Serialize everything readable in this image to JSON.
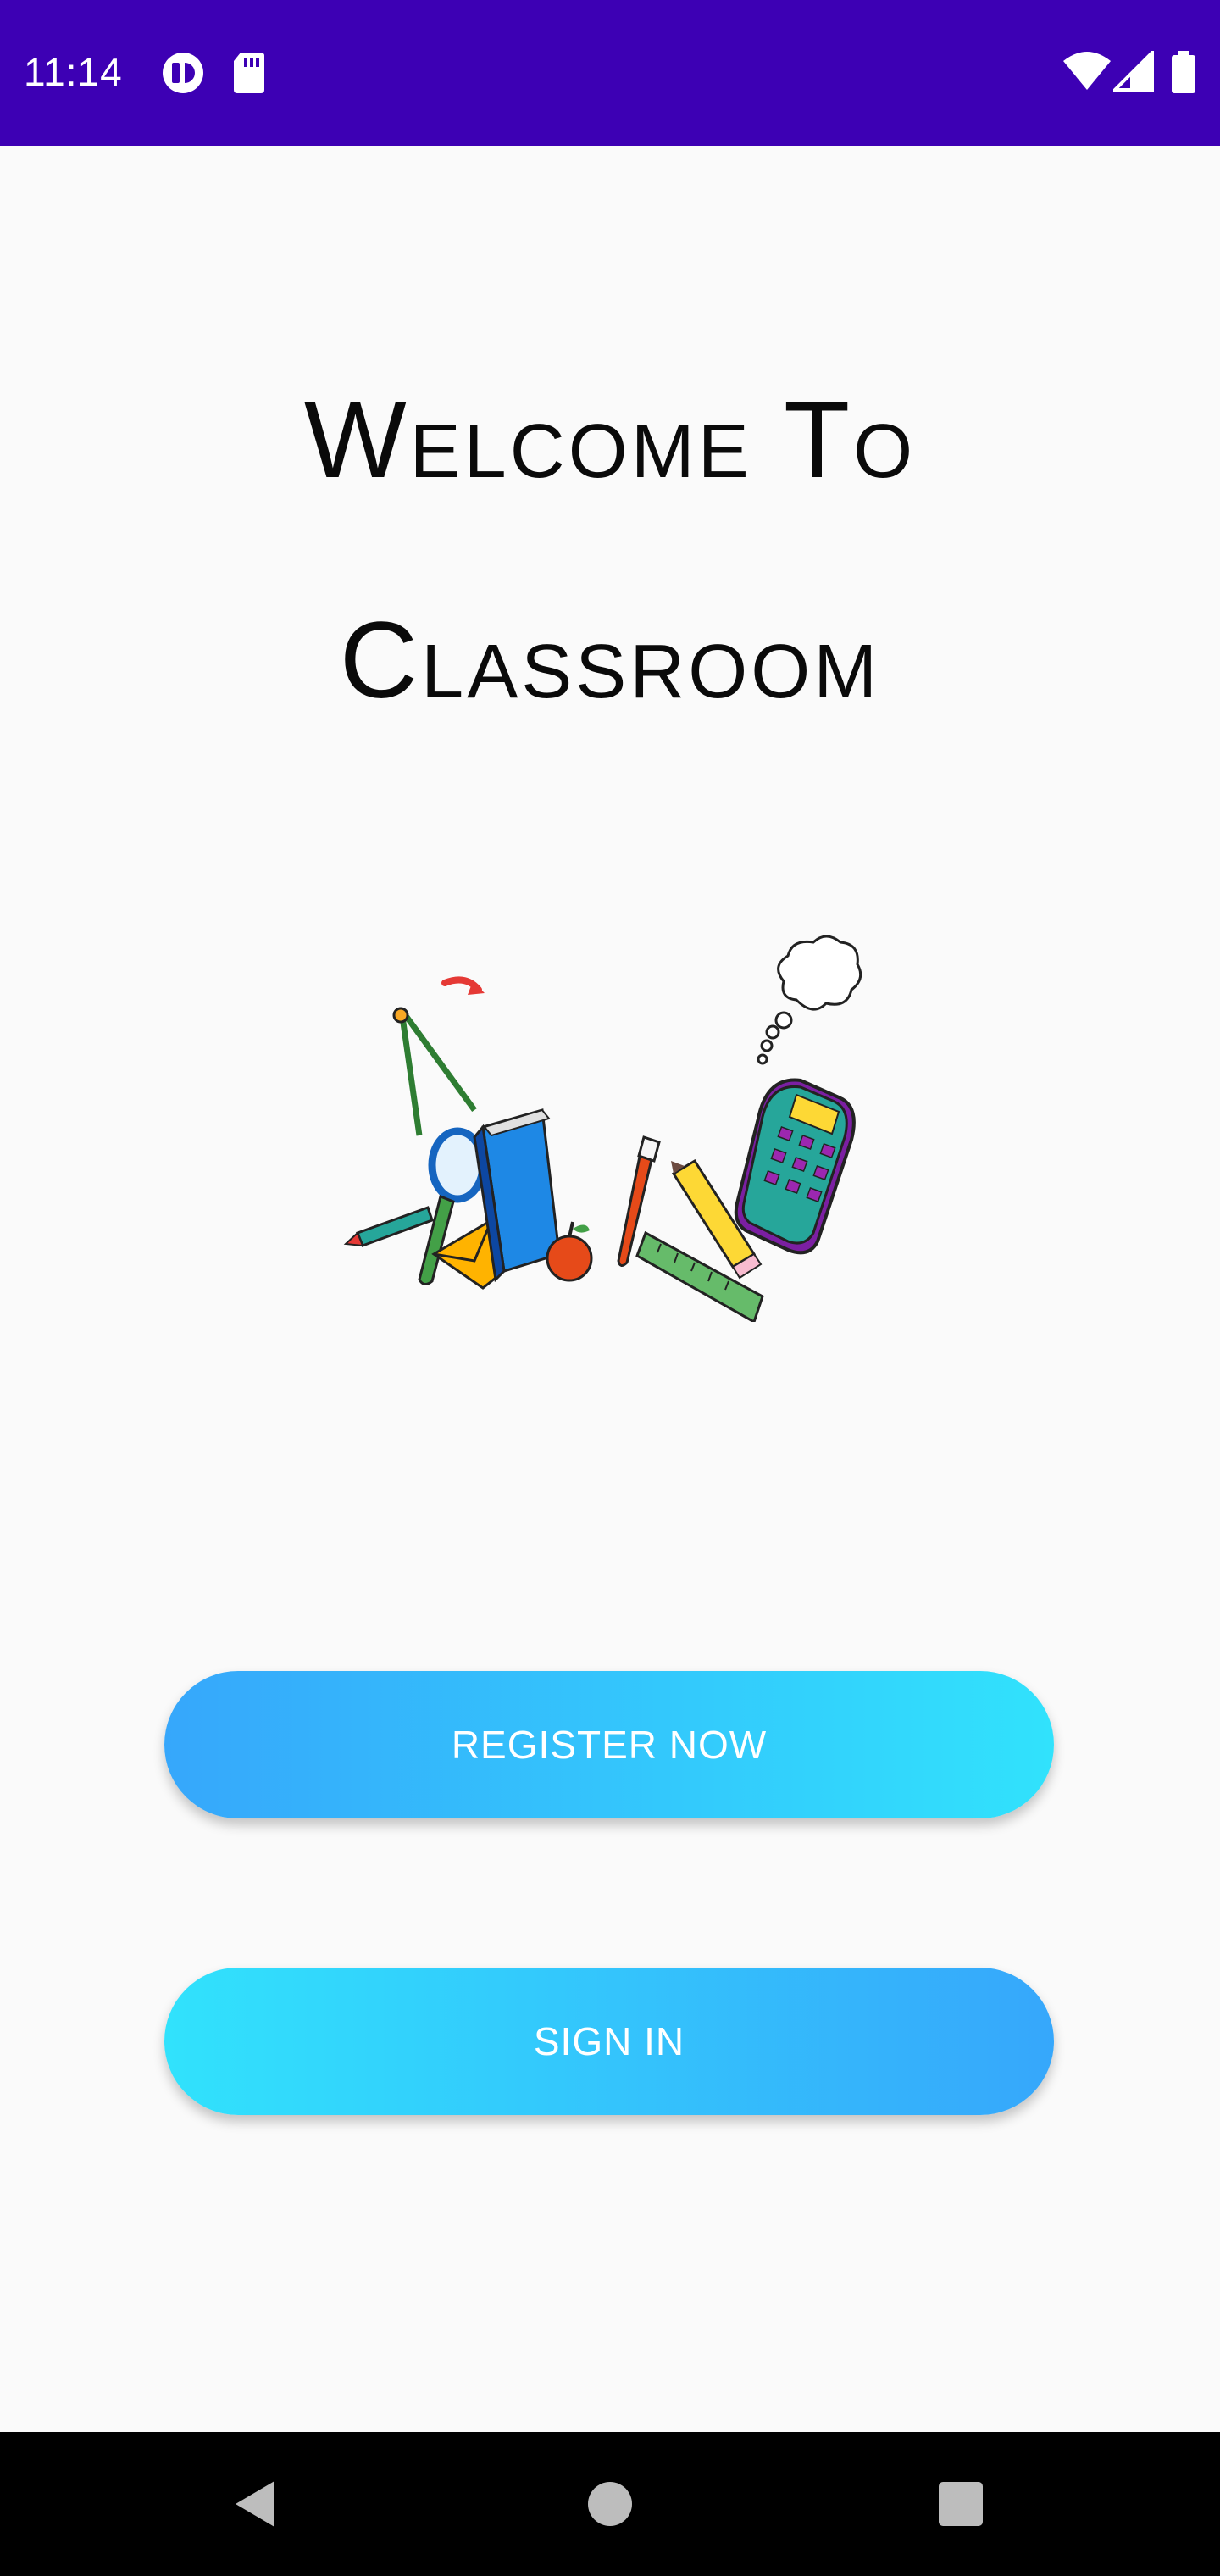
{
  "status_bar": {
    "time": "11:14",
    "background_color": "#3d00b4",
    "left_icons": [
      "media-player-icon",
      "sd-card-icon"
    ],
    "right_icons": [
      "wifi-icon",
      "cell-signal-icon",
      "battery-icon"
    ]
  },
  "welcome": {
    "line1": "Welcome To",
    "line2": "Classroom"
  },
  "illustration": {
    "name": "school-supplies-illustration"
  },
  "buttons": {
    "register_label": "Register Now",
    "signin_label": "Sign In",
    "gradient_start": "#36a7fb",
    "gradient_end": "#31e2fc"
  },
  "nav_bar": {
    "icons": [
      "back-icon",
      "home-icon",
      "recents-icon"
    ]
  }
}
